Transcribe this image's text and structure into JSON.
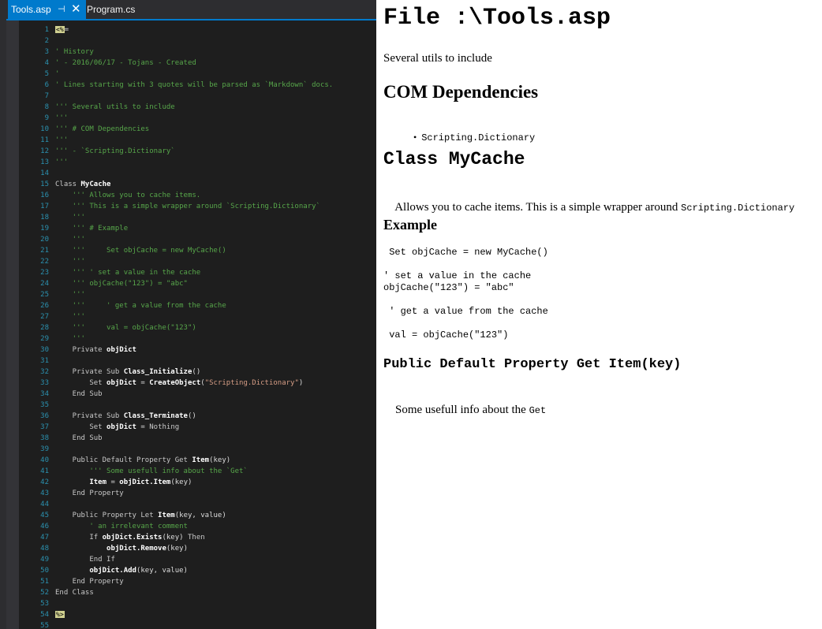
{
  "ide": {
    "tabs": [
      {
        "label": "Tools.asp",
        "active": true
      },
      {
        "label": "Program.cs",
        "active": false
      }
    ],
    "pin_glyph": "⊣",
    "close_glyph": "✕",
    "lines": [
      {
        "n": "1",
        "t": [
          [
            "delim",
            "<%"
          ],
          [
            "plain",
            "="
          ]
        ]
      },
      {
        "n": "2",
        "t": []
      },
      {
        "n": "3",
        "t": [
          [
            "comment",
            "' History"
          ]
        ]
      },
      {
        "n": "4",
        "t": [
          [
            "comment",
            "' - 2016/06/17 - Tojans - Created"
          ]
        ]
      },
      {
        "n": "5",
        "t": [
          [
            "comment",
            "'"
          ]
        ]
      },
      {
        "n": "6",
        "t": [
          [
            "comment",
            "' Lines starting with 3 quotes will be parsed as `Markdown` docs."
          ]
        ]
      },
      {
        "n": "7",
        "t": []
      },
      {
        "n": "8",
        "t": [
          [
            "comment",
            "''' Several utils to include"
          ]
        ]
      },
      {
        "n": "9",
        "t": [
          [
            "comment",
            "'''"
          ]
        ]
      },
      {
        "n": "10",
        "t": [
          [
            "comment",
            "''' # COM Dependencies"
          ]
        ]
      },
      {
        "n": "11",
        "t": [
          [
            "comment",
            "'''"
          ]
        ]
      },
      {
        "n": "12",
        "t": [
          [
            "comment",
            "''' - `Scripting.Dictionary`"
          ]
        ]
      },
      {
        "n": "13",
        "t": [
          [
            "comment",
            "'''"
          ]
        ]
      },
      {
        "n": "14",
        "t": []
      },
      {
        "n": "15",
        "t": [
          [
            "kw",
            "Class "
          ],
          [
            "bold",
            "MyCache"
          ]
        ]
      },
      {
        "n": "16",
        "t": [
          [
            "comment",
            "    ''' Allows you to cache items."
          ]
        ]
      },
      {
        "n": "17",
        "t": [
          [
            "comment",
            "    ''' This is a simple wrapper around `Scripting.Dictionary`"
          ]
        ]
      },
      {
        "n": "18",
        "t": [
          [
            "comment",
            "    '''"
          ]
        ]
      },
      {
        "n": "19",
        "t": [
          [
            "comment",
            "    ''' # Example"
          ]
        ]
      },
      {
        "n": "20",
        "t": [
          [
            "comment",
            "    '''"
          ]
        ]
      },
      {
        "n": "21",
        "t": [
          [
            "comment",
            "    '''     Set objCache = new MyCache()"
          ]
        ]
      },
      {
        "n": "22",
        "t": [
          [
            "comment",
            "    '''"
          ]
        ]
      },
      {
        "n": "23",
        "t": [
          [
            "comment",
            "    ''' ' set a value in the cache"
          ]
        ]
      },
      {
        "n": "24",
        "t": [
          [
            "comment",
            "    ''' objCache(\"123\") = \"abc\""
          ]
        ]
      },
      {
        "n": "25",
        "t": [
          [
            "comment",
            "    '''"
          ]
        ]
      },
      {
        "n": "26",
        "t": [
          [
            "comment",
            "    '''     ' get a value from the cache"
          ]
        ]
      },
      {
        "n": "27",
        "t": [
          [
            "comment",
            "    '''"
          ]
        ]
      },
      {
        "n": "28",
        "t": [
          [
            "comment",
            "    '''     val = objCache(\"123\")"
          ]
        ]
      },
      {
        "n": "29",
        "t": [
          [
            "comment",
            "    '''"
          ]
        ]
      },
      {
        "n": "30",
        "t": [
          [
            "kw",
            "    Private "
          ],
          [
            "bold",
            "objDict"
          ]
        ]
      },
      {
        "n": "31",
        "t": []
      },
      {
        "n": "32",
        "t": [
          [
            "kw",
            "    Private Sub "
          ],
          [
            "bold",
            "Class_Initialize"
          ],
          [
            "plain",
            "()"
          ]
        ]
      },
      {
        "n": "33",
        "t": [
          [
            "kw",
            "        Set "
          ],
          [
            "bold",
            "objDict"
          ],
          [
            "plain",
            " = "
          ],
          [
            "bold",
            "CreateObject"
          ],
          [
            "plain",
            "("
          ],
          [
            "str",
            "\"Scripting.Dictionary\""
          ],
          [
            "plain",
            ")"
          ]
        ]
      },
      {
        "n": "34",
        "t": [
          [
            "kw",
            "    End Sub"
          ]
        ]
      },
      {
        "n": "35",
        "t": []
      },
      {
        "n": "36",
        "t": [
          [
            "kw",
            "    Private Sub "
          ],
          [
            "bold",
            "Class_Terminate"
          ],
          [
            "plain",
            "()"
          ]
        ]
      },
      {
        "n": "37",
        "t": [
          [
            "kw",
            "        Set "
          ],
          [
            "bold",
            "objDict"
          ],
          [
            "plain",
            " = "
          ],
          [
            "kw",
            "Nothing"
          ]
        ]
      },
      {
        "n": "38",
        "t": [
          [
            "kw",
            "    End Sub"
          ]
        ]
      },
      {
        "n": "39",
        "t": []
      },
      {
        "n": "40",
        "t": [
          [
            "kw",
            "    Public Default Property Get "
          ],
          [
            "bold",
            "Item"
          ],
          [
            "plain",
            "(key)"
          ]
        ]
      },
      {
        "n": "41",
        "t": [
          [
            "comment",
            "        ''' Some usefull info about the `Get`"
          ]
        ]
      },
      {
        "n": "42",
        "t": [
          [
            "bold",
            "        Item"
          ],
          [
            "plain",
            " = "
          ],
          [
            "bold",
            "objDict.Item"
          ],
          [
            "plain",
            "(key)"
          ]
        ]
      },
      {
        "n": "43",
        "t": [
          [
            "kw",
            "    End Property"
          ]
        ]
      },
      {
        "n": "44",
        "t": []
      },
      {
        "n": "45",
        "t": [
          [
            "kw",
            "    Public Property Let "
          ],
          [
            "bold",
            "Item"
          ],
          [
            "plain",
            "(key, value)"
          ]
        ]
      },
      {
        "n": "46",
        "t": [
          [
            "comment",
            "        ' an irrelevant comment"
          ]
        ]
      },
      {
        "n": "47",
        "t": [
          [
            "kw",
            "        If "
          ],
          [
            "bold",
            "objDict.Exists"
          ],
          [
            "plain",
            "(key) "
          ],
          [
            "kw",
            "Then"
          ]
        ]
      },
      {
        "n": "48",
        "t": [
          [
            "bold",
            "            objDict.Remove"
          ],
          [
            "plain",
            "(key)"
          ]
        ]
      },
      {
        "n": "49",
        "t": [
          [
            "kw",
            "        End If"
          ]
        ]
      },
      {
        "n": "50",
        "t": [
          [
            "bold",
            "        objDict.Add"
          ],
          [
            "plain",
            "(key, value)"
          ]
        ]
      },
      {
        "n": "51",
        "t": [
          [
            "kw",
            "    End Property"
          ]
        ]
      },
      {
        "n": "52",
        "t": [
          [
            "kw",
            "End Class"
          ]
        ]
      },
      {
        "n": "53",
        "t": []
      },
      {
        "n": "54",
        "t": [
          [
            "delim",
            "%>"
          ]
        ]
      },
      {
        "n": "55",
        "t": []
      }
    ]
  },
  "preview": {
    "title": "File :\\Tools.asp",
    "intro": "Several utils to include",
    "h_com": "COM Dependencies",
    "com_items": [
      "Scripting.Dictionary"
    ],
    "h_class": "Class MyCache",
    "class_desc_text": "Allows you to cache items. This is a simple wrapper around ",
    "class_desc_code": "Scripting.Dictionary",
    "h_example": "Example",
    "example_lines": [
      " Set objCache = new MyCache()",
      "",
      "' set a value in the cache",
      "objCache(\"123\") = \"abc\"",
      "",
      " ' get a value from the cache",
      "",
      " val = objCache(\"123\")"
    ],
    "h_property": "Public Default Property Get Item(key)",
    "property_desc_text": "Some usefull info about the ",
    "property_desc_code": "Get"
  }
}
